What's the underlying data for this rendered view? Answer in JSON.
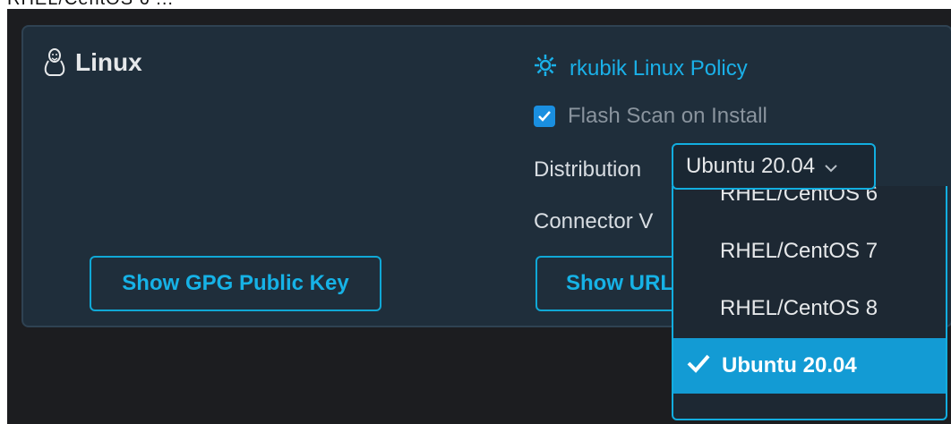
{
  "top_strip": {
    "text": "RHEL/CentOS 6 ..."
  },
  "panel": {
    "title": "Linux",
    "title_icon": "penguin-icon",
    "gpg_button_label": "Show GPG Public Key",
    "policy": {
      "icon": "gear-icon",
      "label": "rkubik Linux Policy"
    },
    "flash_scan": {
      "label": "Flash Scan on Install",
      "checked": true
    },
    "distribution": {
      "label": "Distribution",
      "selected": "Ubuntu 20.04",
      "chevron_icon": "chevron-down-icon"
    },
    "connector_label": "Connector V",
    "url_button_label": "Show URL"
  },
  "dropdown": {
    "options": [
      {
        "label": "RHEL/CentOS 6",
        "selected": false
      },
      {
        "label": "RHEL/CentOS 7",
        "selected": false
      },
      {
        "label": "RHEL/CentOS 8",
        "selected": false
      },
      {
        "label": "Ubuntu 20.04",
        "selected": true
      }
    ],
    "check_icon": "check-icon"
  },
  "colors": {
    "accent": "#139bd4",
    "panel_bg": "#1f2e3b",
    "text": "#e6e8ea"
  }
}
